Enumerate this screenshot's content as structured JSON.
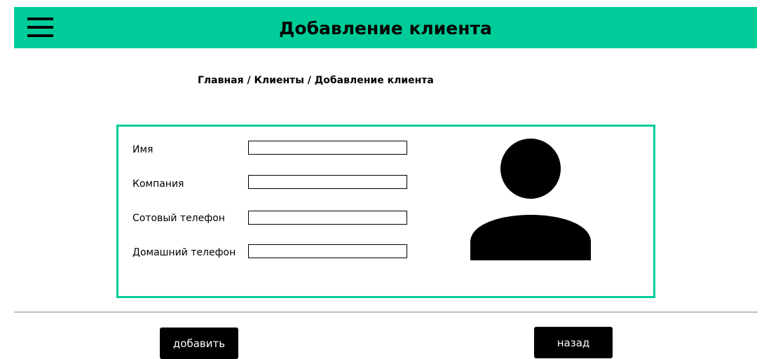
{
  "header": {
    "title": "Добавление клиента",
    "menu_icon": "hamburger-menu-icon",
    "background_color": "#00cc9a"
  },
  "breadcrumb": {
    "items": [
      "Главная",
      "Клиенты",
      "Добавление клиента"
    ],
    "separator": " / "
  },
  "form": {
    "border_color": "#00cc9a",
    "fields": [
      {
        "label": "Имя",
        "value": "",
        "placeholder": ""
      },
      {
        "label": "Компания",
        "value": "",
        "placeholder": ""
      },
      {
        "label": "Сотовый телефон",
        "value": "",
        "placeholder": ""
      },
      {
        "label": "Домашний телефон",
        "value": "",
        "placeholder": ""
      }
    ],
    "avatar_icon": "user-avatar-icon"
  },
  "actions": {
    "add_label": "добавить",
    "back_label": "назад"
  }
}
